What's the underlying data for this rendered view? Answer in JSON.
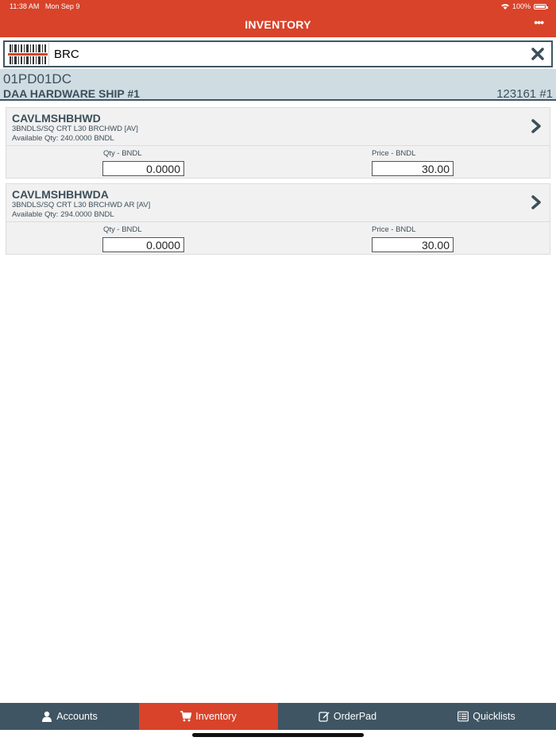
{
  "status_bar": {
    "time": "11:38 AM",
    "date": "Mon Sep 9",
    "battery": "100%"
  },
  "header": {
    "title": "INVENTORY",
    "more_label": "•••"
  },
  "search": {
    "value": "BRC"
  },
  "customer": {
    "code": "01PD01DC",
    "name": "DAA HARDWARE SHIP #1",
    "number": "123161 #1"
  },
  "items": [
    {
      "code": "CAVLMSHBHWD",
      "description": "3BNDLS/SQ CRT L30  BRCHWD [AV]",
      "available": "Available Qty: 240.0000 BNDL",
      "qty_label": "Qty - BNDL",
      "qty_value": "0.0000",
      "price_label": "Price - BNDL",
      "price_value": "30.00"
    },
    {
      "code": "CAVLMSHBHWDA",
      "description": "3BNDLS/SQ CRT L30  BRCHWD AR [AV]",
      "available": "Available Qty: 294.0000 BNDL",
      "qty_label": "Qty - BNDL",
      "qty_value": "0.0000",
      "price_label": "Price - BNDL",
      "price_value": "30.00"
    }
  ],
  "tabs": [
    {
      "label": "Accounts",
      "icon": "user-icon"
    },
    {
      "label": "Inventory",
      "icon": "cart-icon",
      "active": true
    },
    {
      "label": "OrderPad",
      "icon": "edit-icon"
    },
    {
      "label": "Quicklists",
      "icon": "list-icon"
    }
  ],
  "colors": {
    "accent": "#d8432a",
    "dark": "#3f5563",
    "customer_bg": "#cfdde3"
  }
}
